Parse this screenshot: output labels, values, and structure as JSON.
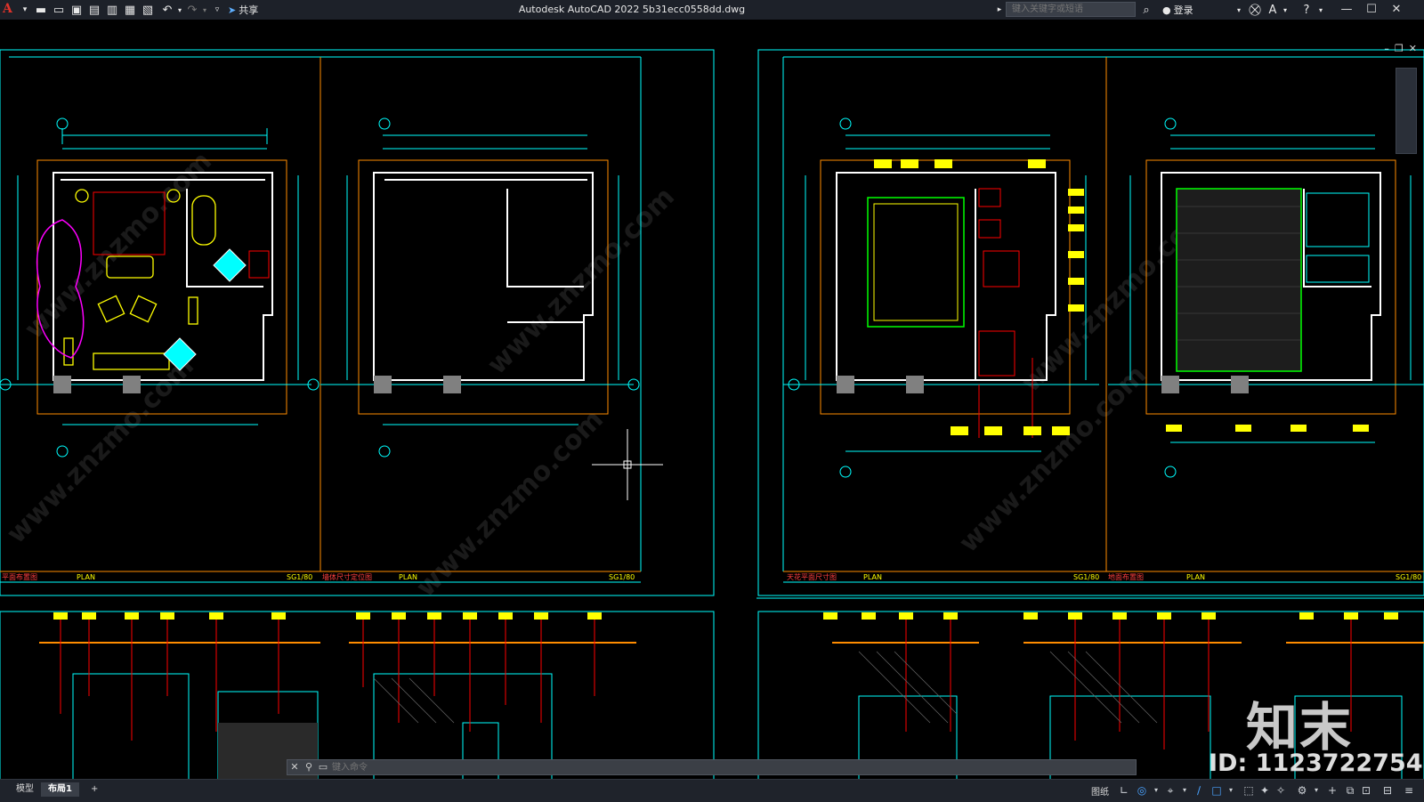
{
  "titlebar": {
    "app_logo": "A",
    "share_label": "共享",
    "window_title": "Autodesk AutoCAD 2022    5b31ecc0558dd.dwg",
    "search_placeholder": "键入关键字或短语",
    "login_label": "登录",
    "icons": [
      "new-icon",
      "open-icon",
      "save-icon",
      "saveas-icon",
      "publish-icon",
      "plot-preview-icon",
      "print-icon",
      "undo-icon",
      "redo-icon",
      "share-icon"
    ]
  },
  "sheets": [
    {
      "title": "平面布置图",
      "plan": "PLAN",
      "num": "SG1/80"
    },
    {
      "title": "墙体尺寸定位图",
      "plan": "PLAN",
      "num": "SG1/80"
    },
    {
      "title": "天花平面尺寸图",
      "plan": "PLAN",
      "num": "SG1/80"
    },
    {
      "title": "地面布置图",
      "plan": "PLAN",
      "num": "SG1/80"
    }
  ],
  "command_line": {
    "placeholder": "键入命令"
  },
  "status_bar": {
    "tabs": [
      "模型",
      "布局1",
      "+"
    ],
    "paper_label": "图纸"
  },
  "watermark": {
    "logo": "知末",
    "id": "ID: 1123722754",
    "site": "www.znzmo.com"
  },
  "colors": {
    "frame": "#00ffff",
    "walls": "#ffffff",
    "dims": "#00ff00",
    "tags": "#ffff00",
    "leaders": "#ff0000",
    "furniture": "#ff00ff",
    "outer": "#ff8c00"
  }
}
